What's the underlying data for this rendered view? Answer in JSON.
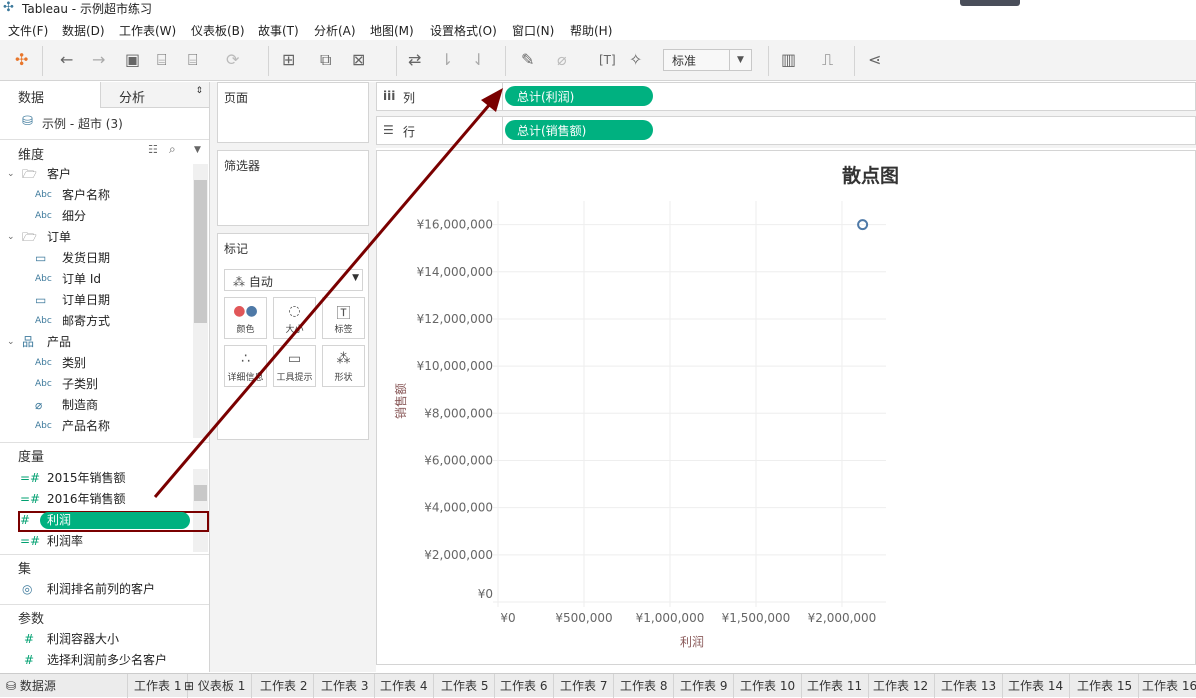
{
  "window": {
    "title": "Tableau - 示例超市练习"
  },
  "menu": [
    "文件(F)",
    "数据(D)",
    "工作表(W)",
    "仪表板(B)",
    "故事(T)",
    "分析(A)",
    "地图(M)",
    "设置格式(O)",
    "窗口(N)",
    "帮助(H)"
  ],
  "toolbar": {
    "fit_value": "标准"
  },
  "left_panel": {
    "tabs": [
      "数据",
      "分析"
    ],
    "datasource": "示例 - 超市 (3)",
    "dimensions_header": "维度",
    "dimensions": [
      {
        "type": "folder",
        "label": "客户"
      },
      {
        "type": "abc",
        "label": "客户名称"
      },
      {
        "type": "abc",
        "label": "细分"
      },
      {
        "type": "folder",
        "label": "订单"
      },
      {
        "type": "date",
        "label": "发货日期"
      },
      {
        "type": "abc",
        "label": "订单 Id"
      },
      {
        "type": "date",
        "label": "订单日期"
      },
      {
        "type": "abc",
        "label": "邮寄方式"
      },
      {
        "type": "hierarchy",
        "label": "产品"
      },
      {
        "type": "abc",
        "label": "类别"
      },
      {
        "type": "abc",
        "label": "子类别"
      },
      {
        "type": "clip",
        "label": "制造商"
      },
      {
        "type": "abc",
        "label": "产品名称"
      }
    ],
    "abc_label": "Abc",
    "measures_header": "度量",
    "measures": [
      "2015年销售额",
      "2016年销售额",
      "利润",
      "利润率"
    ],
    "sets_header": "集",
    "sets": [
      "利润排名前列的客户"
    ],
    "params_header": "参数",
    "params": [
      "利润容器大小",
      "选择利润前多少名客户"
    ]
  },
  "cards": {
    "pages": "页面",
    "filters": "筛选器",
    "marks": "标记",
    "mark_type": "自动",
    "mark_buttons": [
      "颜色",
      "大小",
      "标签",
      "详细信息",
      "工具提示",
      "形状"
    ]
  },
  "shelves": {
    "columns_label": "列",
    "columns_pill": "总计(利润)",
    "rows_label": "行",
    "rows_pill": "总计(销售额)"
  },
  "chart_data": {
    "type": "scatter",
    "title": "散点图",
    "xlabel": "利润",
    "ylabel": "销售额",
    "xlim": [
      0,
      2256000
    ],
    "ylim": [
      0,
      17000000
    ],
    "xticks": [
      0,
      500000,
      1000000,
      1500000,
      2000000
    ],
    "xtick_labels": [
      "¥0",
      "¥500,000",
      "¥1,000,000",
      "¥1,500,000",
      "¥2,000,000"
    ],
    "yticks": [
      0,
      2000000,
      4000000,
      6000000,
      8000000,
      10000000,
      12000000,
      14000000,
      16000000
    ],
    "ytick_labels": [
      "¥0",
      "¥2,000,000",
      "¥4,000,000",
      "¥6,000,000",
      "¥8,000,000",
      "¥10,000,000",
      "¥12,000,000",
      "¥14,000,000",
      "¥16,000,000"
    ],
    "points": [
      {
        "x": 2120000,
        "y": 16000000
      }
    ],
    "grid": true,
    "mark_color": "#4e79a7"
  },
  "sheet_tabs": [
    "数据源",
    "工作表 1",
    "仪表板 1",
    "工作表 2",
    "工作表 3",
    "工作表 4",
    "工作表 5",
    "工作表 6",
    "工作表 7",
    "工作表 8",
    "工作表 9",
    "工作表 10",
    "工作表 11",
    "工作表 12",
    "工作表 13",
    "工作表 14",
    "工作表 15",
    "工作表 16"
  ],
  "colors": {
    "pill": "#00b180",
    "annotation": "#7a0000"
  }
}
